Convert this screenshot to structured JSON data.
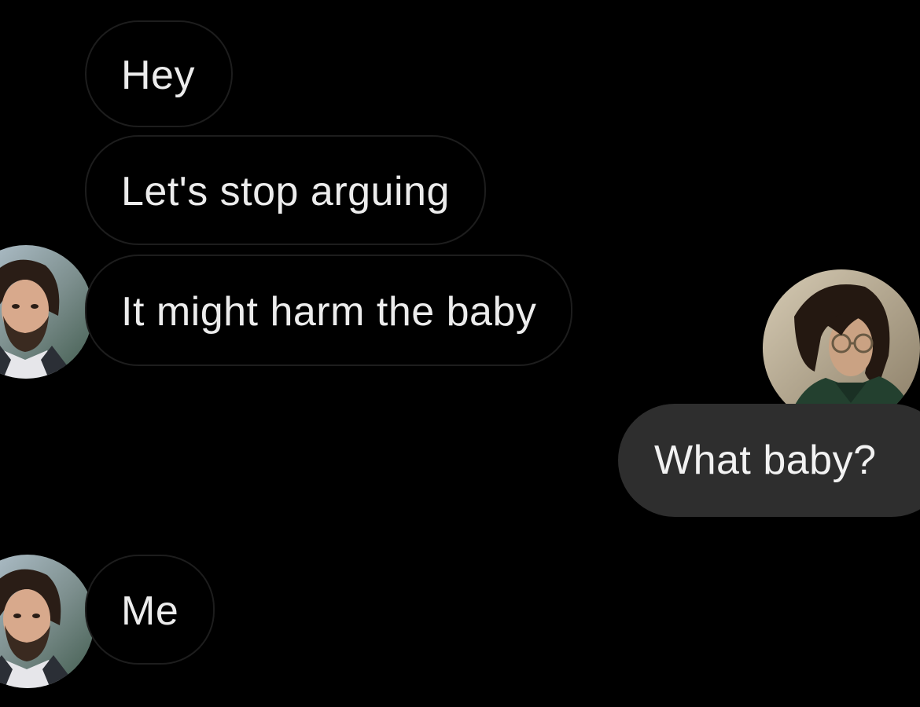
{
  "conversation": {
    "messages": [
      {
        "sender": "incoming",
        "text": "Hey"
      },
      {
        "sender": "incoming",
        "text": "Let's stop arguing"
      },
      {
        "sender": "incoming",
        "text": "It might harm the baby"
      },
      {
        "sender": "outgoing",
        "text": "What baby?"
      },
      {
        "sender": "incoming",
        "text": "Me"
      }
    ],
    "avatars": {
      "incoming": "bearded-man-avatar",
      "outgoing": "glasses-man-avatar"
    }
  },
  "colors": {
    "background": "#000000",
    "incoming_bubble_border": "#1d1d1d",
    "outgoing_bubble_fill": "#2e2e2e",
    "text": "#ececec"
  }
}
